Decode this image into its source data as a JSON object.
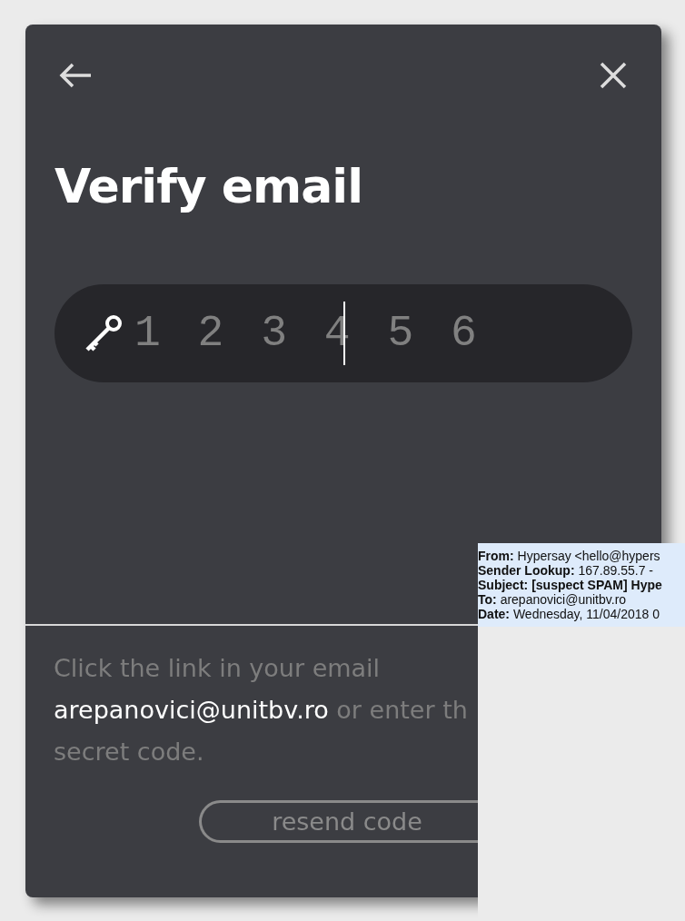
{
  "dialog": {
    "title": "Verify email",
    "code_field": {
      "placeholder": "1 2 3 4 5 6"
    },
    "message_lines": [
      {
        "kind": "text",
        "text": "Click the link in your email"
      },
      {
        "kind": "email",
        "email": "arepanovici@unitbv.ro",
        "text": "or enter th"
      },
      {
        "kind": "text",
        "text": "secret code."
      }
    ],
    "resend_button": "resend code"
  },
  "email_header": [
    {
      "label": "From:",
      "value": "Hypersay <hello@hypers",
      "bold": false
    },
    {
      "label": "Sender Lookup:",
      "value": "167.89.55.7 -",
      "bold": false
    },
    {
      "label": "Subject:",
      "value": "[suspect SPAM] Hype",
      "bold": true
    },
    {
      "label": "To:",
      "value": "arepanovici@unitbv.ro",
      "bold": false
    },
    {
      "label": "Date:",
      "value": "Wednesday, 11/04/2018 0",
      "bold": false
    }
  ]
}
